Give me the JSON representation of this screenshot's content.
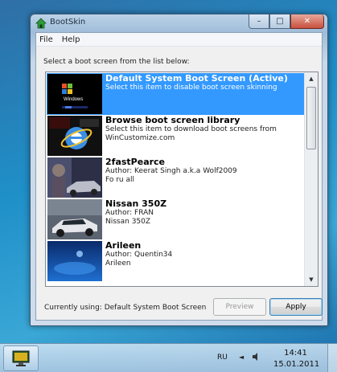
{
  "window": {
    "title": "BootSkin",
    "minimize_glyph": "–",
    "maximize_glyph": "□",
    "close_glyph": "✕"
  },
  "menu": {
    "items": [
      "File",
      "Help"
    ]
  },
  "instruction": "Select a boot screen from the list below:",
  "list": {
    "items": [
      {
        "title": "Default System Boot Screen (Active)",
        "lines": [
          "Select this item to disable boot screen skinning"
        ],
        "selected": true,
        "thumb_icon": "windows-xp-icon"
      },
      {
        "title": "Browse boot screen library",
        "lines": [
          "Select this item to download boot screens from",
          "WinCustomize.com"
        ],
        "selected": false,
        "thumb_icon": "internet-explorer-icon"
      },
      {
        "title": "2fastPearce",
        "lines": [
          "Author: Keerat Singh a.k.a Wolf2009",
          "Fo ru all"
        ],
        "selected": false,
        "thumb_icon": "car-thumbnail"
      },
      {
        "title": "Nissan 350Z",
        "lines": [
          "Author: FRAN",
          "Nissan 350Z"
        ],
        "selected": false,
        "thumb_icon": "car-thumbnail"
      },
      {
        "title": "Arileen",
        "lines": [
          "Author: Quentin34",
          "Arileen"
        ],
        "selected": false,
        "thumb_icon": "blue-thumbnail"
      }
    ]
  },
  "status": {
    "text": "Currently using: Default System Boot Screen"
  },
  "buttons": {
    "preview": "Preview",
    "apply": "Apply"
  },
  "taskbar": {
    "lang": "RU",
    "tray_arrow": "◄",
    "time": "14:41",
    "date": "15.01.2011"
  },
  "colors": {
    "selection": "#3399ff",
    "window_frame": "#9fbcd8"
  }
}
